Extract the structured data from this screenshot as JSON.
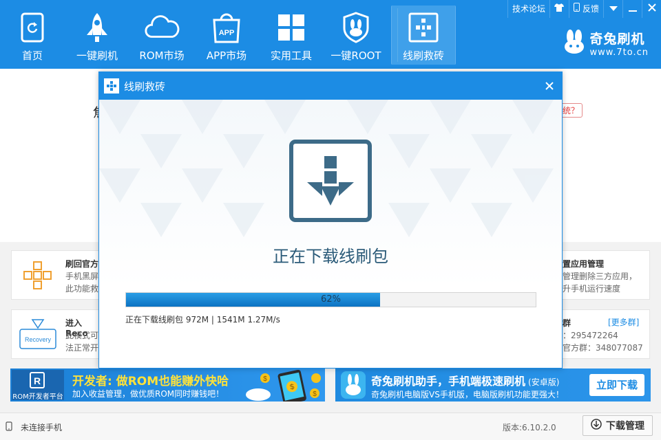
{
  "app": {
    "accent": "#1c8ce4"
  },
  "nav": [
    {
      "label": "首页",
      "icon": "home-icon"
    },
    {
      "label": "一键刷机",
      "icon": "rocket-icon"
    },
    {
      "label": "ROM市场",
      "icon": "cloud-icon"
    },
    {
      "label": "APP市场",
      "icon": "app-bag-icon"
    },
    {
      "label": "实用工具",
      "icon": "grid-icon"
    },
    {
      "label": "一键ROOT",
      "icon": "rabbit-shield-icon"
    },
    {
      "label": "线刷救砖",
      "icon": "rescue-icon",
      "active": true
    }
  ],
  "topright": {
    "forum": "技术论坛",
    "feedback": "反馈"
  },
  "brand": {
    "name": "奇兔刷机",
    "url": "www.7to.cn"
  },
  "background": {
    "question_badge": "统？",
    "cut_char": "焦",
    "cards": [
      {
        "title": "刷回官方",
        "lines": [
          "手机黑屏",
          "此功能救"
        ]
      },
      {
        "title": "进入Reco",
        "lines": [
          "此模式可",
          "法正常开"
        ],
        "icon_text": "Recovery"
      },
      {
        "title": "置应用管理",
        "lines": [
          "管理删除三方应用，",
          "升手机运行速度"
        ]
      },
      {
        "title": "群",
        "more": "[更多群]",
        "lines": [
          "：295472264",
          "官方群：348077087"
        ]
      }
    ]
  },
  "banners": {
    "left": {
      "logo_text": "ROM开发者平台",
      "headline_prefix": "开发者: ",
      "headline": "做ROM也能赚外快哈",
      "sub": "加入收益管理，做优质ROM同时赚钱吧！"
    },
    "right": {
      "headline": "奇兔刷机助手，手机端极速刷机",
      "tag": "(安卓版)",
      "sub": "奇兔刷机电脑版VS手机版，电脑版刷机功能更强大！",
      "button": "立即下载"
    }
  },
  "modal": {
    "title": "线刷救砖",
    "status": "正在下载线刷包",
    "progress": 0.62,
    "progress_label": "62%",
    "info": "正在下载线刷包 972M | 1541M 1.27M/s"
  },
  "statusbar": {
    "phone_status": "未连接手机",
    "version": "版本:6.10.2.0",
    "download_manager": "下载管理"
  }
}
